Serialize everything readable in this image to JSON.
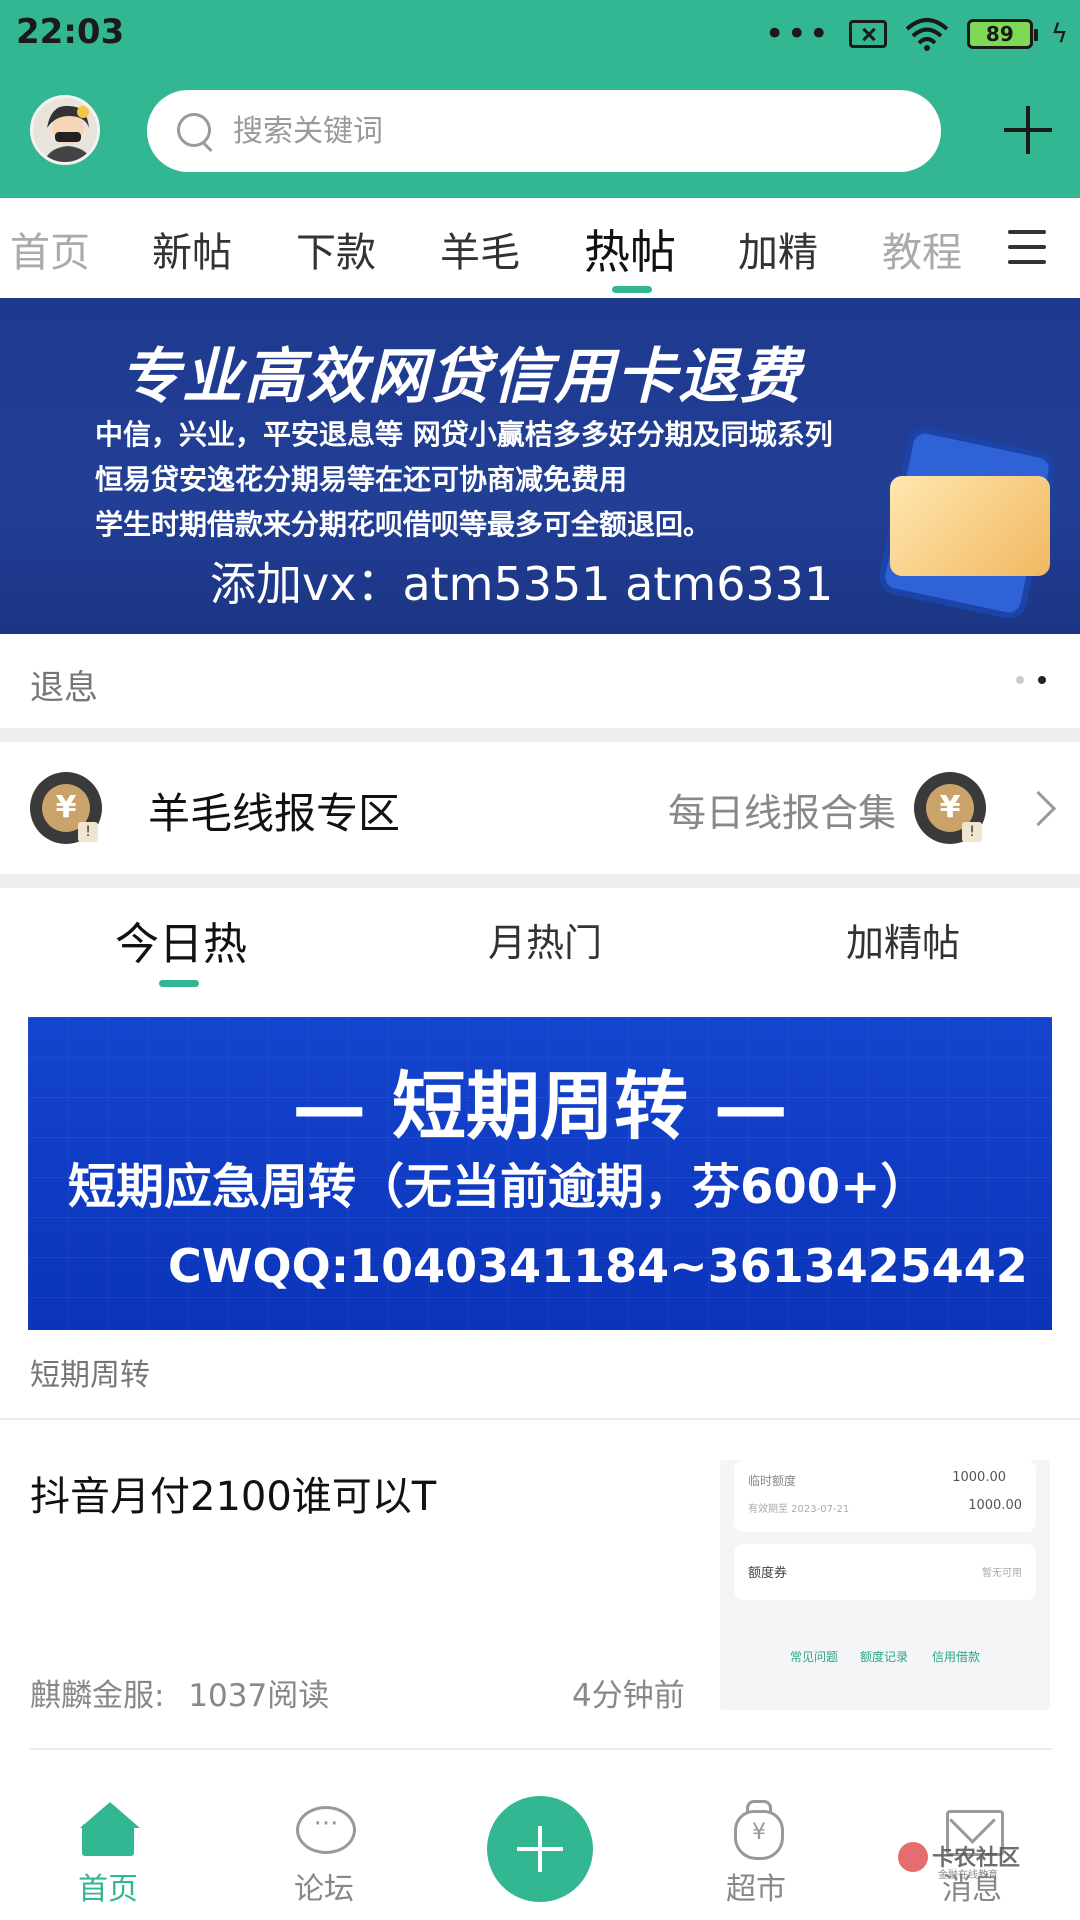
{
  "status_bar": {
    "time": "22:03",
    "battery": "89"
  },
  "header": {
    "search_placeholder": "搜索关键词"
  },
  "category_tabs": [
    "首页",
    "新帖",
    "下款",
    "羊毛",
    "热帖",
    "加精",
    "教程"
  ],
  "active_category": "热帖",
  "banner1": {
    "title": "专业高效网贷信用卡退费",
    "lines": [
      "中信，兴业，平安退息等 网贷小赢桔多多好分期及同城系列",
      "恒易贷安逸花分期易等在还可协商减免费用",
      "学生时期借款来分期花呗借呗等最多可全额退回。"
    ],
    "contact": "添加vx：atm5351  atm6331",
    "caption": "退息"
  },
  "section": {
    "title": "羊毛线报专区",
    "subtitle": "每日线报合集"
  },
  "hot_tabs": [
    "今日热",
    "月热门",
    "加精帖"
  ],
  "active_hot_tab": "今日热",
  "banner2": {
    "title": "— 短期周转 —",
    "line": "短期应急周转（无当前逾期，芬600+）",
    "contact": "CWQQ:1040341184~3613425442",
    "caption": "短期周转"
  },
  "post": {
    "title": "抖音月付2100谁可以T",
    "author": "麒麟金服:",
    "reads": "1037阅读",
    "time": "4分钟前",
    "thumbnail": {
      "label1": "临时额度",
      "value1": "1000.00",
      "date": "有效期至 2023-07-21",
      "value2": "1000.00",
      "label2": "额度券",
      "label2_status": "暂无可用",
      "links": [
        "常见问题",
        "额度记录",
        "信用借款"
      ]
    }
  },
  "bottom_nav": {
    "items": [
      "首页",
      "论坛",
      "超市",
      "消息"
    ],
    "active": "首页"
  },
  "watermark": {
    "name": "卡农社区",
    "sub": "金融在线教育"
  },
  "colors": {
    "accent": "#33b792",
    "banner1_bg": "#223f96",
    "banner2_bg": "#1444cf"
  }
}
